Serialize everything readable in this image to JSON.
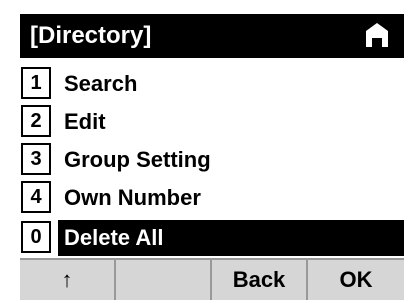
{
  "title": "[Directory]",
  "title_icon": "handset-icon",
  "menu": [
    {
      "key": "1",
      "label": "Search"
    },
    {
      "key": "2",
      "label": "Edit"
    },
    {
      "key": "3",
      "label": "Group Setting"
    },
    {
      "key": "4",
      "label": "Own Number"
    },
    {
      "key": "0",
      "label": "Delete All",
      "selected": true
    }
  ],
  "softkeys": [
    "↑",
    "",
    "Back",
    "OK"
  ]
}
